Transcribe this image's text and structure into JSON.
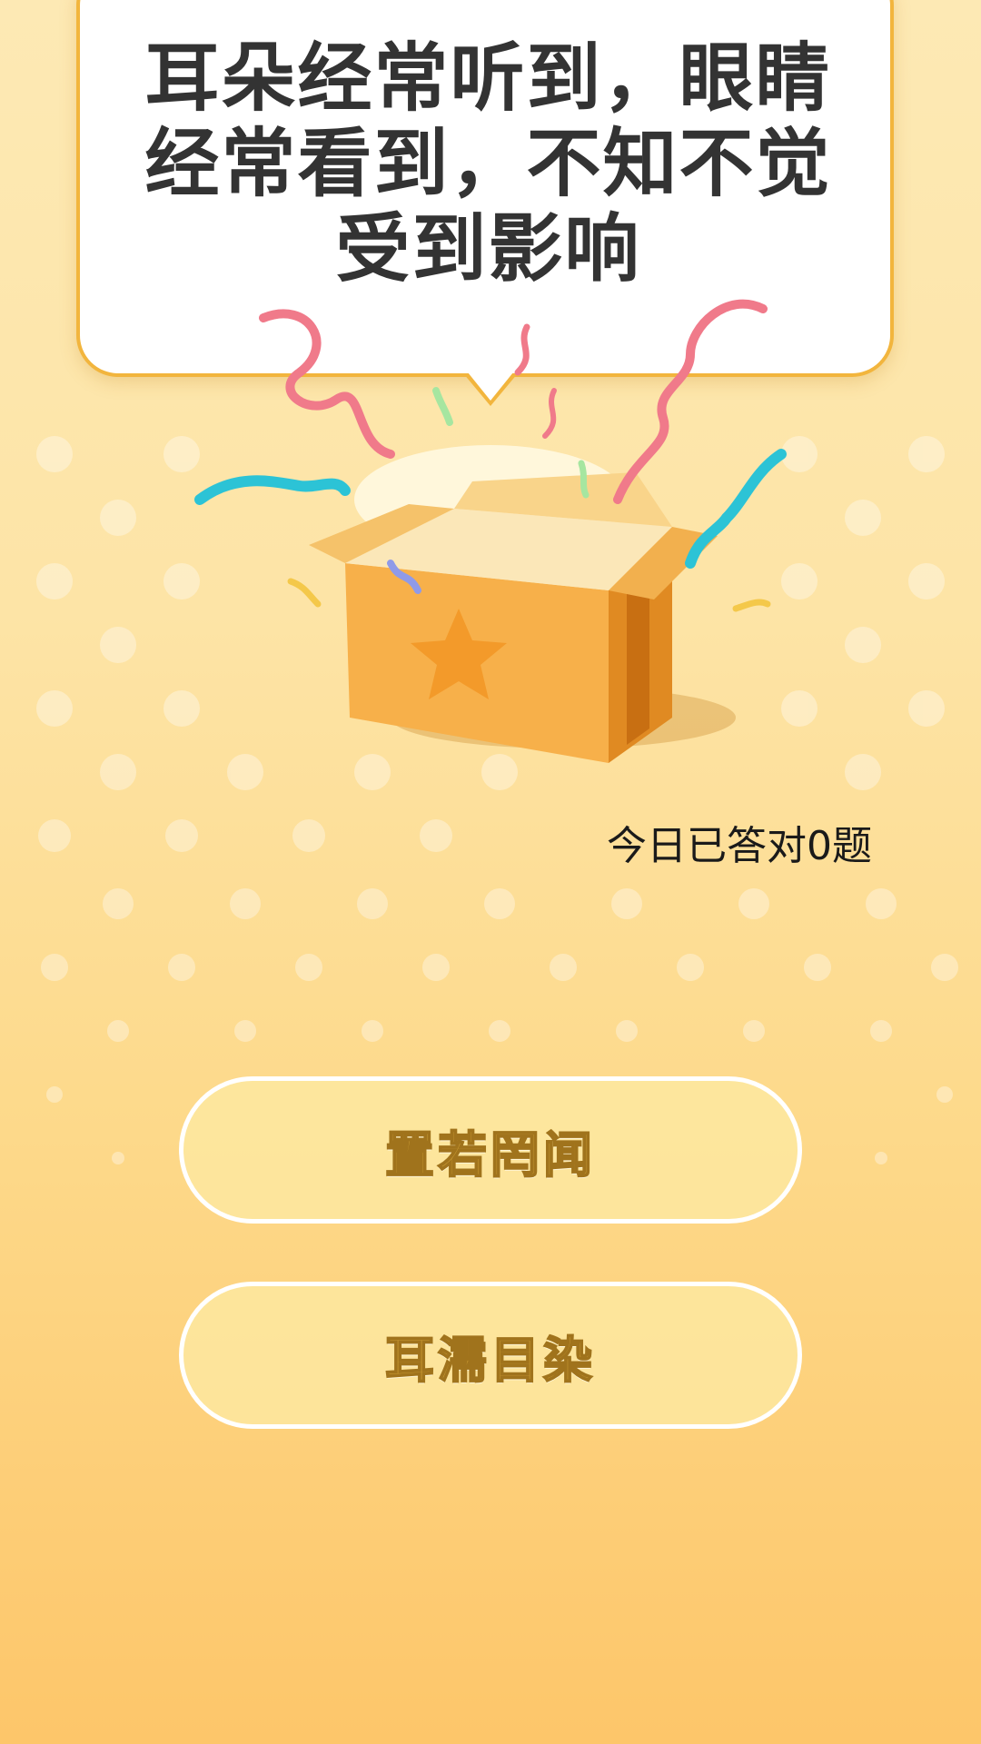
{
  "question": {
    "text": "耳朵经常听到，眼睛经常看到，不知不觉受到影响"
  },
  "status": {
    "correct_today": "今日已答对0题"
  },
  "options": [
    {
      "label": "置若罔闻"
    },
    {
      "label": "耳濡目染"
    }
  ],
  "illustration": {
    "icon": "open-gift-box-with-ribbons-icon",
    "colors": {
      "box": "#f7b04a",
      "box_side": "#e08a22",
      "star": "#f39a2a",
      "ribbon_pink": "#f07a8a",
      "ribbon_cyan": "#2cc3d6"
    }
  },
  "theme": {
    "background_top": "#fde9b4",
    "background_bottom": "#fdc66a",
    "bubble_border": "#f2b53d",
    "option_border": "#ffffff"
  }
}
